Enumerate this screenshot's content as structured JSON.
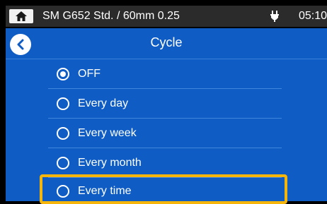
{
  "status_bar": {
    "home_icon": "home-icon",
    "title": "SM G652 Std. / 60mm 0.25",
    "power_icon": "plug-icon",
    "time": "05:10"
  },
  "header": {
    "back_icon": "chevron-left-icon",
    "title": "Cycle"
  },
  "options": [
    {
      "label": "OFF",
      "selected": true
    },
    {
      "label": "Every day",
      "selected": false
    },
    {
      "label": "Every week",
      "selected": false
    },
    {
      "label": "Every month",
      "selected": false
    },
    {
      "label": "Every time",
      "selected": false,
      "highlighted": true
    }
  ],
  "colors": {
    "screen_background": "#0e5cc4",
    "status_bar_background": "#2b2b2b",
    "highlight_border": "#f5b50a"
  }
}
